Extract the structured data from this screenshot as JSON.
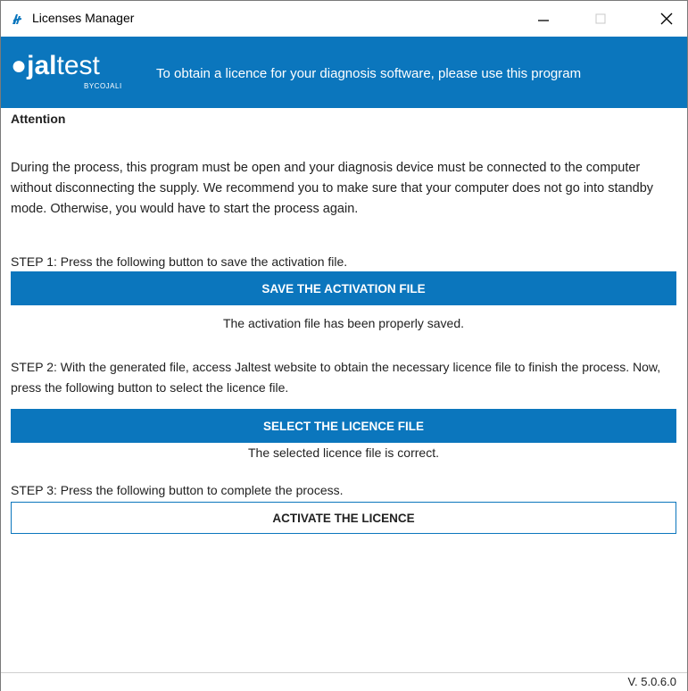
{
  "window": {
    "title": "Licenses Manager",
    "controls": {
      "minimize": "minimize",
      "maximize": "maximize",
      "close": "close"
    }
  },
  "header": {
    "logo_text_bold": "jal",
    "logo_text_light": "test",
    "logo_sub": "BYCOJALI",
    "tagline": "To obtain a licence for your diagnosis software, please use this program"
  },
  "content": {
    "attention_title": "Attention",
    "attention_text": "During the process, this program must be open and your diagnosis device must be connected to the computer without disconnecting the supply. We recommend you to make sure that your computer does not go into standby mode. Otherwise, you would have to start the process again.",
    "step1": {
      "text": "STEP 1: Press the following button to save the activation file.",
      "button": "SAVE THE ACTIVATION FILE",
      "message": "The activation file has been properly saved."
    },
    "step2": {
      "text": "STEP 2: With the generated file, access Jaltest website to obtain the necessary licence file to finish the process. Now, press the following button to select the licence file.",
      "button": "SELECT THE LICENCE FILE",
      "message": "The selected licence file is correct."
    },
    "step3": {
      "text": "STEP 3: Press the following button to complete the process.",
      "button": "ACTIVATE THE LICENCE"
    }
  },
  "status": {
    "version": "V. 5.0.6.0"
  },
  "colors": {
    "accent": "#0b76bd",
    "text": "#222222",
    "background": "#ffffff"
  },
  "icons": [
    "app-icon",
    "minimize-icon",
    "maximize-icon",
    "close-icon"
  ]
}
